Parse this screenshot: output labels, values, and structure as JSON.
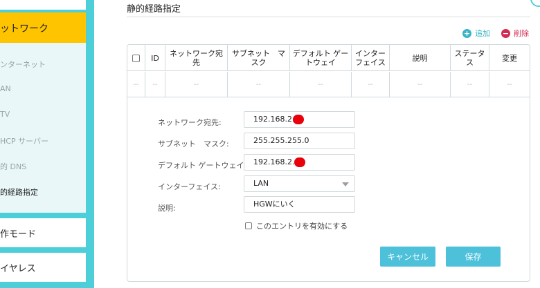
{
  "sidebar": {
    "active": "ットワーク",
    "sub_items": [
      {
        "label": "ンターネット"
      },
      {
        "label": "AN"
      },
      {
        "label": "TV"
      },
      {
        "label": "HCP サーバー"
      },
      {
        "label": "的 DNS"
      },
      {
        "label": "的経路指定"
      }
    ],
    "menu": [
      {
        "label": "作モード"
      },
      {
        "label": "イヤレス"
      }
    ]
  },
  "page": {
    "title": "静的経路指定",
    "add_label": "追加",
    "delete_label": "削除"
  },
  "table": {
    "headers": {
      "id": "ID",
      "dest": "ネットワーク宛先",
      "mask": "サブネット　マスク",
      "gateway": "デフォルト ゲートウェイ",
      "iface": "インターフェイス",
      "desc": "説明",
      "status": "ステータス",
      "modify": "変更"
    },
    "row": [
      "--",
      "--",
      "--",
      "--",
      "--",
      "--",
      "--",
      "--",
      "--"
    ]
  },
  "form": {
    "dest_label": "ネットワーク宛先:",
    "dest_value": "192.168.2.",
    "mask_label": "サブネット　マスク:",
    "mask_value": "255.255.255.0",
    "gateway_label": "デフォルト ゲートウェイ:",
    "gateway_value": "192.168.2.",
    "iface_label": "インターフェイス:",
    "iface_value": "LAN",
    "desc_label": "説明:",
    "desc_value": "HGWにいく",
    "enable_label": "このエントリを有効にする",
    "enable_checked": false,
    "cancel_label": "キャンセル",
    "save_label": "保存"
  },
  "colors": {
    "accent": "#4dcfd9",
    "active_item": "#ffc400",
    "button": "#4dc0da",
    "add": "#3ab4c4",
    "delete": "#d32c54",
    "redaction": "#e8000b"
  },
  "icons": {
    "add": "plus-circle-icon",
    "delete": "minus-circle-icon",
    "select": "chevron-down-icon"
  }
}
